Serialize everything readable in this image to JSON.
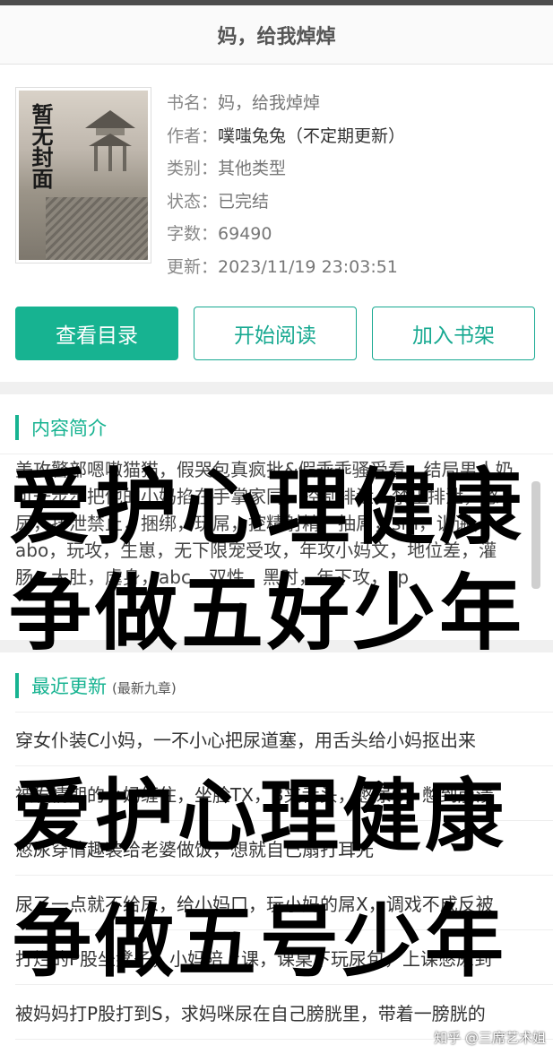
{
  "header": {
    "title": "妈，给我焯焯"
  },
  "book": {
    "cover_text": "暂无封面",
    "title_label": "书名：",
    "title_value": "妈，给我焯焯",
    "author_label": "作者：",
    "author_value": "噗嗤兔兔（不定期更新）",
    "category_label": "类别：",
    "category_value": "其他类型",
    "status_label": "状态：",
    "status_value": "已完结",
    "words_label": "字数：",
    "words_value": "69490",
    "updated_label": "更新：",
    "updated_value": "2023/11/19 23:03:51"
  },
  "buttons": {
    "catalog": "查看目录",
    "read": "开始阅读",
    "shelf": "加入书架"
  },
  "intro": {
    "title": "内容简介",
    "text": "美攻警部嗯嗷猫猫，假哭包真疯批&假乖乖骚受看，结局男人奶可一步步把他的小妈掐在手掌家同，控制排泄，禁止排泄，憋尿，排泄禁止，捆绑，玩屌，控精射精，抽屌，sm，训诫，abo，玩攻，生崽，无下限宠受攻，年攻小妈文，地位差，灌肠，大肚，虐身，abc，双性，黑时，年下攻，sp"
  },
  "recent": {
    "title": "最近更新",
    "subtitle": "(最新九章)",
    "chapters": [
      "穿女仆装C小妈，一不小心把尿道塞，用舌头给小妈抠出来",
      "被发情期的小妈缠住，坐脸TX，B夹舌头，憋尿C，憋到崩溃",
      "憋尿穿情趣装给老婆做饭，想就自己扇打耳光",
      "尿了一点就不给尿，给小妈口，玩小妈的屌X，调戏不成反被",
      "打烂的P股坐凳子，小妈陪上课，课桌下玩尿包，上课憋尿到",
      "被妈妈打P股打到S，求妈咪尿在自己膀胱里，带着一膀胱的"
    ]
  },
  "overlays": {
    "line1": "爱护心理健康",
    "line2": "争做五好少年",
    "line3": "爱护心理健康",
    "line4": "争做五号少年"
  },
  "watermark": "知乎 @三席艺术姐"
}
